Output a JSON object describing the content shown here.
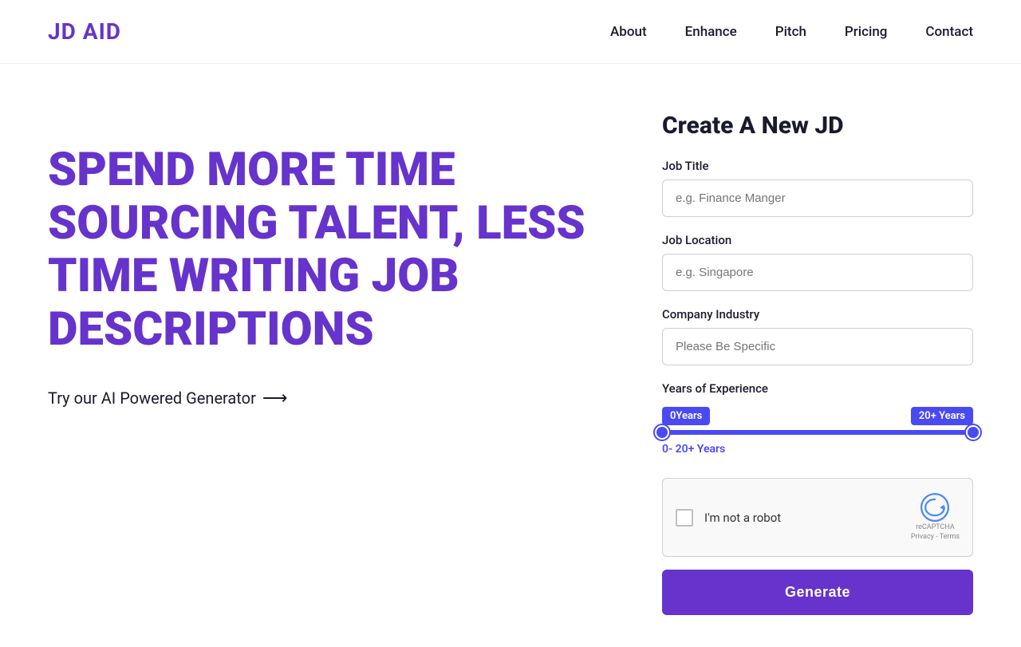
{
  "logo": {
    "text": "JD AID"
  },
  "nav": {
    "items": [
      {
        "label": "About",
        "id": "about"
      },
      {
        "label": "Enhance",
        "id": "enhance"
      },
      {
        "label": "Pitch",
        "id": "pitch"
      },
      {
        "label": "Pricing",
        "id": "pricing"
      },
      {
        "label": "Contact",
        "id": "contact"
      }
    ]
  },
  "hero": {
    "title": "SPEND MORE TIME SOURCING TALENT, LESS TIME WRITING JOB DESCRIPTIONS",
    "subtitle": "Try our AI Powered Generator",
    "arrow": "⟶"
  },
  "form": {
    "title": "Create A New JD",
    "job_title_label": "Job Title",
    "job_title_placeholder": "e.g. Finance Manger",
    "job_location_label": "Job Location",
    "job_location_placeholder": "e.g. Singapore",
    "company_industry_label": "Company Industry",
    "company_industry_placeholder": "Please Be Specific",
    "years_exp_label": "Years of Experience",
    "slider_min_badge": "0Years",
    "slider_max_badge": "20+ Years",
    "slider_range_text": "0- 20+ Years",
    "recaptcha_text": "I'm not a robot",
    "recaptcha_brand1": "reCAPTCHA",
    "recaptcha_brand2": "Privacy - Terms",
    "generate_label": "Generate"
  }
}
